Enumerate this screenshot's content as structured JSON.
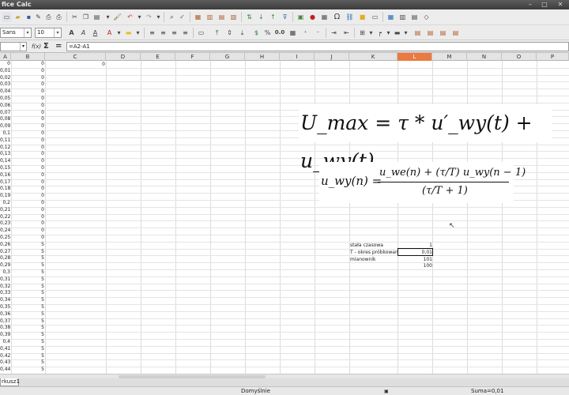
{
  "window": {
    "title": "fice Calc",
    "min": "–",
    "max": "□",
    "close": "✕"
  },
  "toolbar2": {
    "font_name": "Sans",
    "font_size": "10",
    "percent": "%",
    "decimal": "0.0"
  },
  "formula_bar": {
    "cell_ref": "",
    "fx": "f(x)",
    "sigma": "Σ",
    "equals": "=",
    "content": "=A2-A1"
  },
  "columns": [
    "A",
    "B",
    "C",
    "D",
    "E",
    "F",
    "G",
    "H",
    "I",
    "J",
    "K",
    "L",
    "M",
    "N",
    "O",
    "P"
  ],
  "selected_column": "L",
  "col_a": [
    "0",
    "0,01",
    "0,02",
    "0,03",
    "0,04",
    "0,05",
    "0,06",
    "0,07",
    "0,08",
    "0,09",
    "0,1",
    "0,11",
    "0,12",
    "0,13",
    "0,14",
    "0,15",
    "0,16",
    "0,17",
    "0,18",
    "0,19",
    "0,2",
    "0,21",
    "0,22",
    "0,23",
    "0,24",
    "0,25",
    "0,26",
    "0,27",
    "0,28",
    "0,29",
    "0,3",
    "0,31",
    "0,32",
    "0,33",
    "0,34",
    "0,35",
    "0,36",
    "0,37",
    "0,38",
    "0,39",
    "0,4",
    "0,41",
    "0,42",
    "0,43",
    "0,44"
  ],
  "col_b": [
    "0",
    "0",
    "0",
    "0",
    "0",
    "0",
    "0",
    "0",
    "0",
    "0",
    "0",
    "0",
    "0",
    "0",
    "0",
    "0",
    "0",
    "0",
    "0",
    "0",
    "0",
    "0",
    "0",
    "0",
    "0",
    "0",
    "5",
    "5",
    "5",
    "5",
    "5",
    "5",
    "5",
    "5",
    "5",
    "5",
    "5",
    "5",
    "5",
    "5",
    "5",
    "5",
    "5",
    "5",
    "5"
  ],
  "c1_value": "0",
  "params": [
    {
      "label": "stała czasowa",
      "value": "1"
    },
    {
      "label": "T - okres próbkowania",
      "value": "0,01"
    },
    {
      "label": "mianownik",
      "value": "101"
    },
    {
      "label": "",
      "value": "100"
    }
  ],
  "formulas": {
    "f1": "U_max = τ * u′_wy(t) + u_wy(t)",
    "f2_lhs": "u_wy(n) =",
    "f2_num": "u_we(n) + (τ/T) u_wy(n − 1)",
    "f2_den": "(τ/T + 1)"
  },
  "sheet_tab": "rkusz1",
  "status": {
    "style": "Domyślnie",
    "sum": "Suma=0,01"
  }
}
